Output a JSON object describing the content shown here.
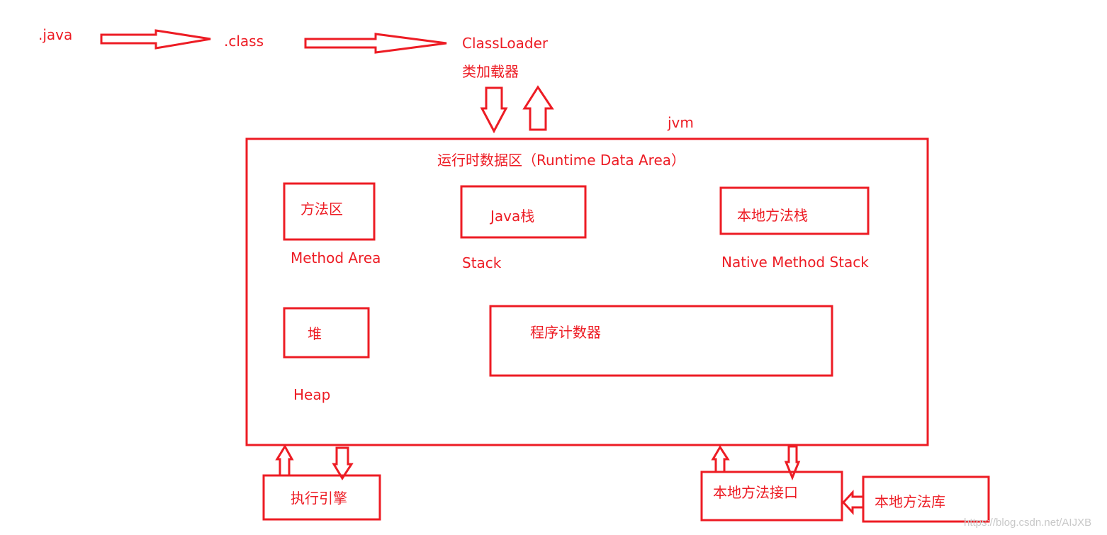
{
  "colors": {
    "stroke": "#ed1c24",
    "text": "#ed1c24",
    "watermark": "#c8c8c8"
  },
  "flow": {
    "java": ".java",
    "class": ".class",
    "classloader": "ClassLoader",
    "classloader_cn": "类加载器"
  },
  "jvm": {
    "label": "jvm",
    "runtime_area_title": "运行时数据区（Runtime Data Area）",
    "method_area": {
      "cn": "方法区",
      "en": "Method Area"
    },
    "stack": {
      "cn": "Java栈",
      "en": "Stack"
    },
    "native_stack": {
      "cn": "本地方法栈",
      "en": "Native Method Stack"
    },
    "heap": {
      "cn": "堆",
      "en": "Heap"
    },
    "pc_register": {
      "cn": "程序计数器"
    }
  },
  "bottom": {
    "execution_engine": "执行引擎",
    "native_interface": "本地方法接口",
    "native_library": "本地方法库"
  },
  "watermark": "https://blog.csdn.net/AIJXB"
}
